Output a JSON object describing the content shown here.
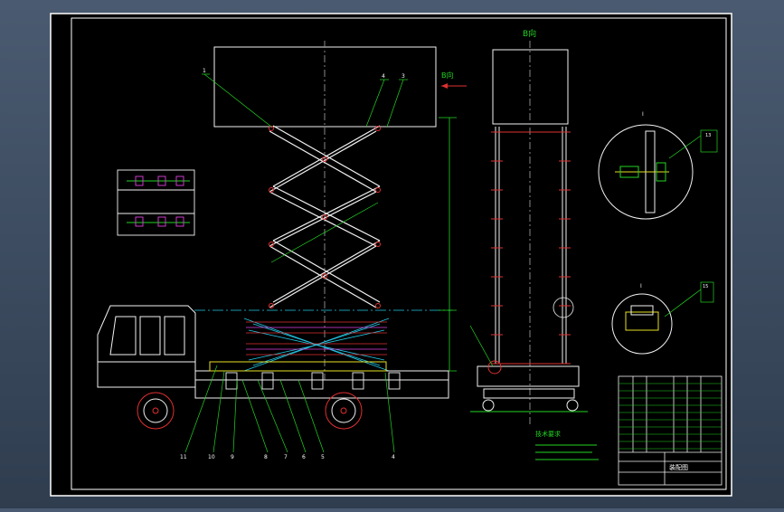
{
  "view_label_top": "B向",
  "view_arrow_label": "B向",
  "detail_label_upper": "I",
  "detail_label_lower": "I",
  "part_numbers_top": [
    "1",
    "4",
    "3"
  ],
  "part_numbers_bottom": [
    "11",
    "10",
    "9",
    "8",
    "7",
    "6",
    "5",
    "4"
  ],
  "part_numbers_detail": [
    "13",
    "15"
  ],
  "title_block_caption": "装配图",
  "notes_title": "技术要求",
  "colors": {
    "frame": "#ffffff",
    "paper": "#000000",
    "line_white": "#f2f2f2",
    "line_green": "#22d422",
    "line_cyan": "#22c8e6",
    "line_red": "#e03030",
    "line_magenta": "#e040e0",
    "line_yellow": "#e6e022"
  }
}
